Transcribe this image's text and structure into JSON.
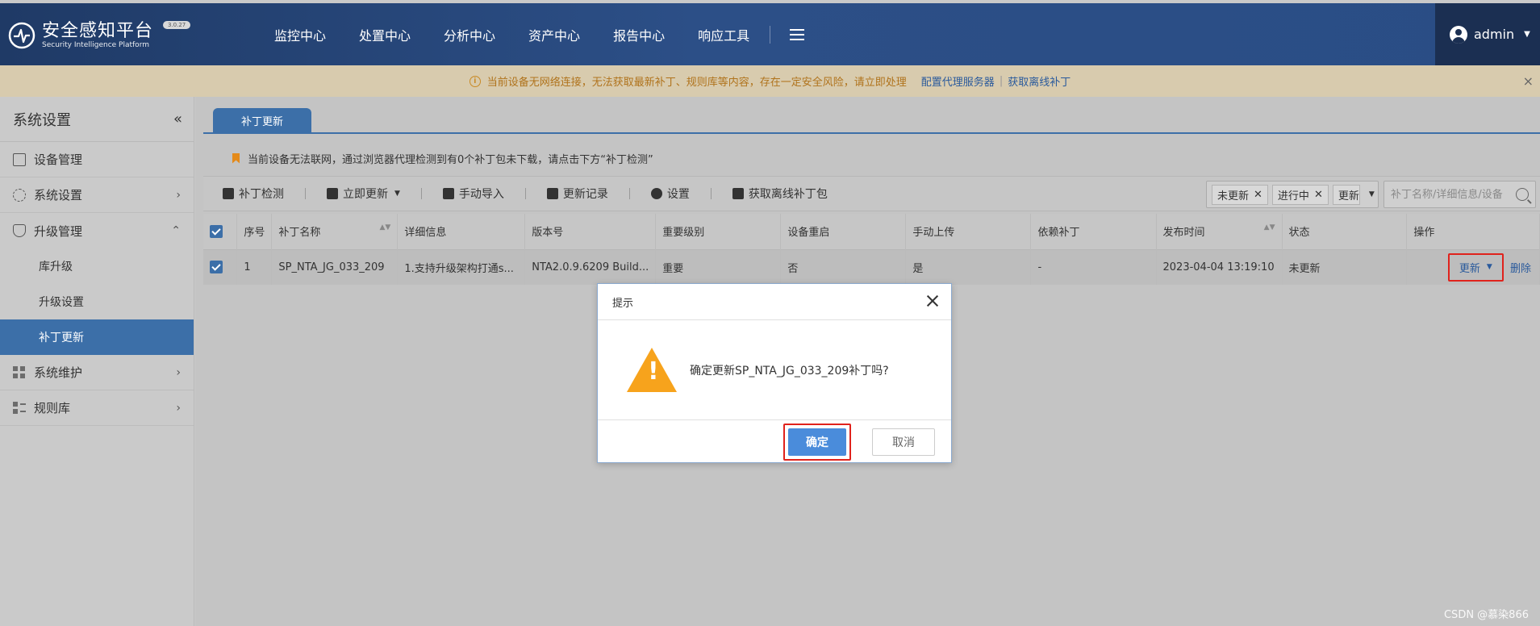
{
  "header": {
    "brand_title": "安全感知平台",
    "brand_subtitle": "Security Intelligence Platform",
    "version": "3.0.27",
    "nav": [
      "监控中心",
      "处置中心",
      "分析中心",
      "资产中心",
      "报告中心",
      "响应工具"
    ],
    "user": "admin"
  },
  "warning_bar": {
    "message": "当前设备无网络连接，无法获取最新补丁、规则库等内容，存在一定安全风险，请立即处理",
    "link_proxy": "配置代理服务器",
    "separator": "|",
    "link_offline": "获取离线补丁",
    "close": "×"
  },
  "sidebar": {
    "title": "系统设置",
    "collapse": "«",
    "items": [
      {
        "label": "设备管理",
        "icon": "device-icon"
      },
      {
        "label": "系统设置",
        "icon": "gear-icon"
      },
      {
        "label": "升级管理",
        "icon": "shield-icon"
      },
      {
        "label": "库升级"
      },
      {
        "label": "升级设置"
      },
      {
        "label": "补丁更新"
      },
      {
        "label": "系统维护",
        "icon": "grid-icon"
      },
      {
        "label": "规则库",
        "icon": "list-icon"
      }
    ]
  },
  "main": {
    "tab": "补丁更新",
    "notice": "当前设备无法联网，通过浏览器代理检测到有0个补丁包未下载，请点击下方“补丁检测”",
    "toolbar": {
      "check": "补丁检测",
      "update_now": "立即更新",
      "manual_import": "手动导入",
      "history": "更新记录",
      "settings": "设置",
      "offline_pkg": "获取离线补丁包"
    },
    "filter": {
      "chip1": "未更新",
      "chip2": "进行中",
      "chip3": "更新"
    },
    "search_placeholder": "补丁名称/详细信息/设备",
    "table": {
      "headers": [
        "序号",
        "补丁名称",
        "详细信息",
        "版本号",
        "重要级别",
        "设备重启",
        "手动上传",
        "依赖补丁",
        "发布时间",
        "状态",
        "操作"
      ],
      "rows": [
        {
          "index": "1",
          "name": "SP_NTA_JG_033_209",
          "detail": "1.支持升级架构打通s...",
          "version": "NTA2.0.9.6209 Build...",
          "level": "重要",
          "restart": "否",
          "manual": "是",
          "depends": "-",
          "release_time": "2023-04-04 13:19:10",
          "status": "未更新",
          "op_update": "更新",
          "op_delete": "删除"
        }
      ]
    }
  },
  "dialog": {
    "title": "提示",
    "message": "确定更新SP_NTA_JG_033_209补丁吗?",
    "ok": "确定",
    "cancel": "取消"
  },
  "watermark": "CSDN @慕染866",
  "colors": {
    "header_bg": "#2a4d85",
    "accent": "#3c6fa8",
    "warning": "#f7a31c",
    "highlight": "#e0221c"
  }
}
